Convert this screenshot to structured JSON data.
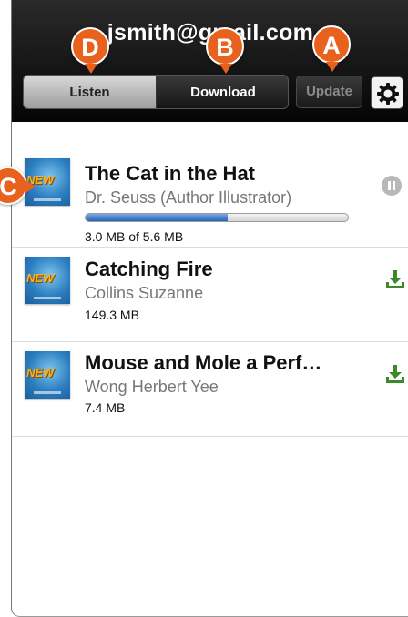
{
  "header": {
    "account": "jsmith@gmail.com"
  },
  "toolbar": {
    "listen_label": "Listen",
    "download_label": "Download",
    "update_label": "Update",
    "settings_icon": "gear-icon"
  },
  "books": [
    {
      "title": "The Cat in the Hat",
      "author": "Dr. Seuss (Author  Illustrator)",
      "size": "3.0 MB of 5.6 MB",
      "badge": "NEW",
      "status": "downloading",
      "progress": 0.54,
      "action_icon": "pause-icon"
    },
    {
      "title": "Catching Fire",
      "author": "Collins  Suzanne",
      "size": "149.3 MB",
      "badge": "NEW",
      "status": "available",
      "action_icon": "download-icon"
    },
    {
      "title": "Mouse and Mole a Perf…",
      "author": "Wong Herbert Yee",
      "size": "7.4 MB",
      "badge": "NEW",
      "status": "available",
      "action_icon": "download-icon"
    }
  ],
  "callouts": {
    "a": "A",
    "b": "B",
    "c": "C",
    "d": "D"
  },
  "colors": {
    "accent_callout": "#e8611d",
    "progress_fill": "#2a63b8",
    "download_icon": "#3a8a2a"
  }
}
